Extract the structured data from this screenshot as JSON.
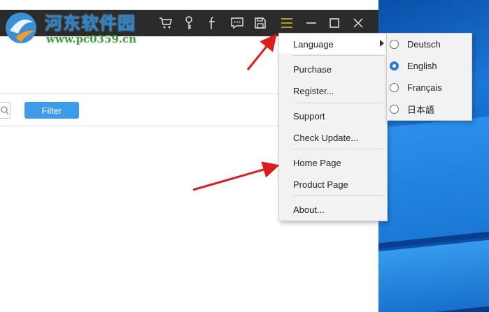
{
  "watermark": {
    "site_name": "河东软件园",
    "url": "www.pc0359.cn"
  },
  "titlebar": {
    "icons": [
      "cart-icon",
      "key-icon",
      "facebook-icon",
      "chat-icon",
      "save-icon",
      "menu-icon",
      "minimize-icon",
      "maximize-icon",
      "close-icon"
    ]
  },
  "toolbar": {
    "filter_label": "Filter"
  },
  "menu": {
    "language": "Language",
    "purchase": "Purchase",
    "register": "Register...",
    "support": "Support",
    "check_update": "Check Update...",
    "home_page": "Home Page",
    "product_page": "Product Page",
    "about": "About..."
  },
  "language_submenu": {
    "options": [
      "Deutsch",
      "English",
      "Français",
      "日本語"
    ],
    "selected": "English"
  },
  "colors": {
    "titlebar": "#2b2b2b",
    "accent": "#3e9be8",
    "menu_highlight_icon": "#e0c020",
    "annotation_arrow": "#e01b1b"
  }
}
